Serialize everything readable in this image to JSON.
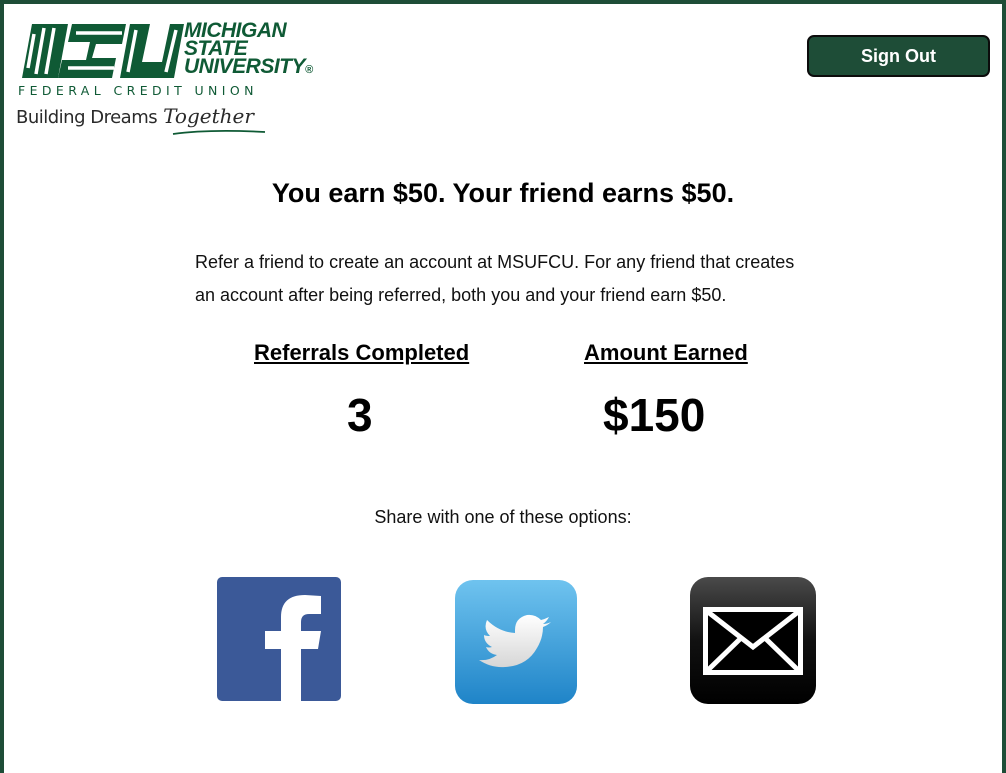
{
  "logo": {
    "word_line1": "MICHIGAN",
    "word_line2": "STATE",
    "word_line3": "UNIVERSITY",
    "registered": "®",
    "subtitle": "FEDERAL CREDIT UNION",
    "tagline_main": "Building Dreams",
    "tagline_script": "Together",
    "mark_letters": "MSU",
    "brand_color": "#0f5a35"
  },
  "header": {
    "signout_label": "Sign Out",
    "button_color": "#1e4d37"
  },
  "main": {
    "headline": "You earn $50. Your friend earns $50.",
    "description_line1": "Refer a friend to create an account at MSUFCU. For any friend that creates",
    "description_line2": "an account after being referred, both you and your friend earn $50.",
    "stats": {
      "referrals_label": "Referrals Completed",
      "referrals_value": "3",
      "earned_label": "Amount Earned",
      "earned_value": "$150"
    },
    "share_prompt": "Share with one of these options:",
    "share_options": [
      {
        "name": "facebook",
        "icon": "facebook-icon",
        "color": "#3b5998"
      },
      {
        "name": "twitter",
        "icon": "twitter-icon",
        "color": "#3ea3df"
      },
      {
        "name": "email",
        "icon": "envelope-icon",
        "color": "#111111"
      }
    ]
  }
}
